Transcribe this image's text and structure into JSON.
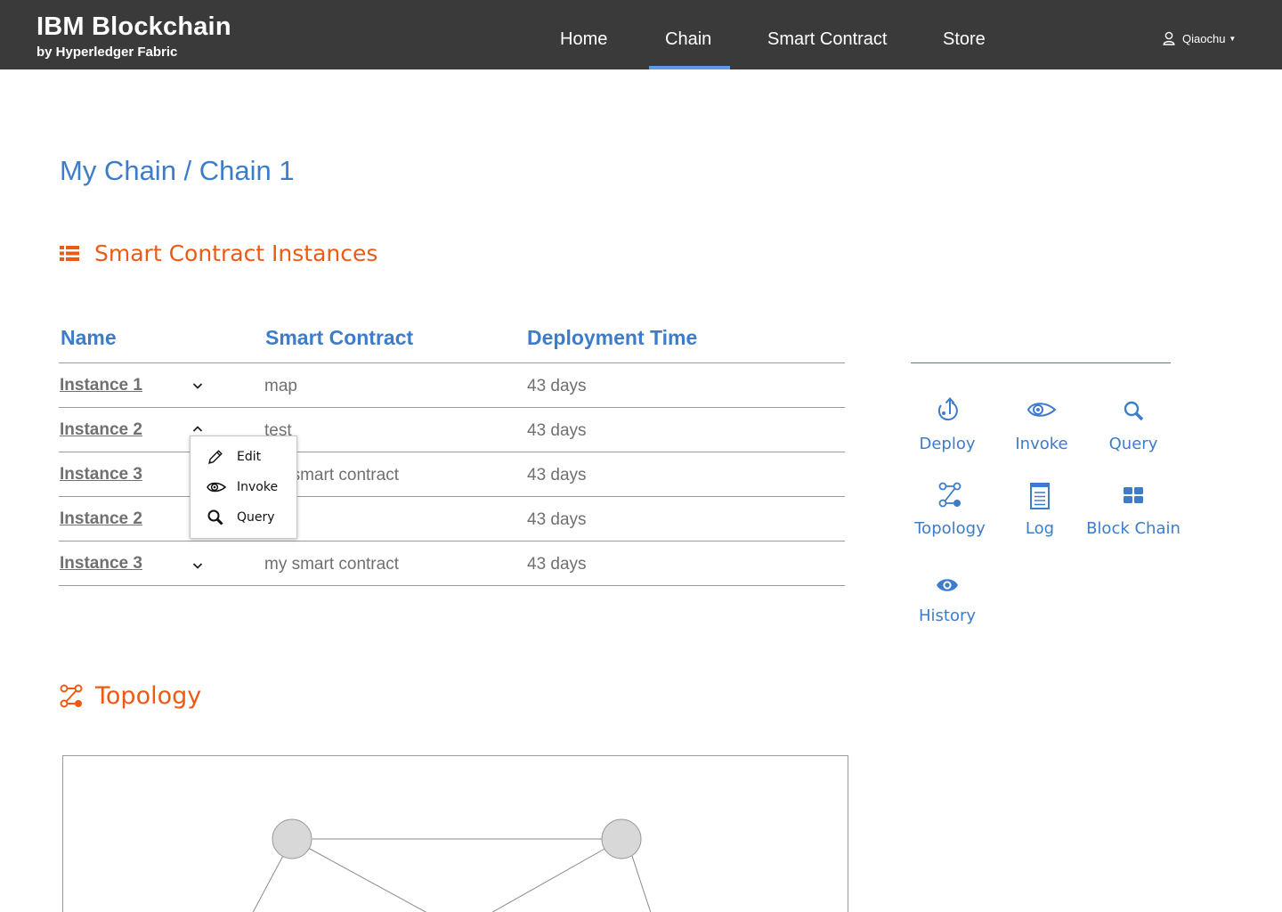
{
  "header": {
    "brand_title": "IBM Blockchain",
    "brand_subtitle": "by Hyperledger Fabric",
    "nav": [
      "Home",
      "Chain",
      "Smart Contract",
      "Store"
    ],
    "active_nav": "Chain",
    "user_name": "Qiaochu"
  },
  "page": {
    "breadcrumb": "My Chain / Chain 1"
  },
  "instances_section": {
    "title": "Smart Contract Instances",
    "columns": [
      "Name",
      "Smart Contract",
      "Deployment Time"
    ],
    "rows": [
      {
        "name": "Instance 1",
        "smart_contract": "map",
        "time": "43 days",
        "expanded": false
      },
      {
        "name": "Instance 2",
        "smart_contract": "test",
        "time": "43 days",
        "expanded": true
      },
      {
        "name": "Instance 3",
        "smart_contract": "my smart contract",
        "time": "43 days",
        "expanded": false
      },
      {
        "name": "Instance 2",
        "smart_contract": "",
        "time": "43 days",
        "expanded": false
      },
      {
        "name": "Instance 3",
        "smart_contract": "my smart contract",
        "time": "43 days",
        "expanded": false
      }
    ],
    "dropdown_menu": [
      "Edit",
      "Invoke",
      "Query"
    ]
  },
  "actions": {
    "items": [
      "Deploy",
      "Invoke",
      "Query",
      "Topology",
      "Log",
      "Block Chain",
      "History"
    ],
    "color": "#3d7cc9"
  },
  "topology_section": {
    "title": "Topology"
  },
  "colors": {
    "header_bg": "#3a3a3a",
    "accent_blue": "#3d7cc9",
    "accent_orange": "#ee5a14",
    "nav_active": "#5a9ae6"
  }
}
